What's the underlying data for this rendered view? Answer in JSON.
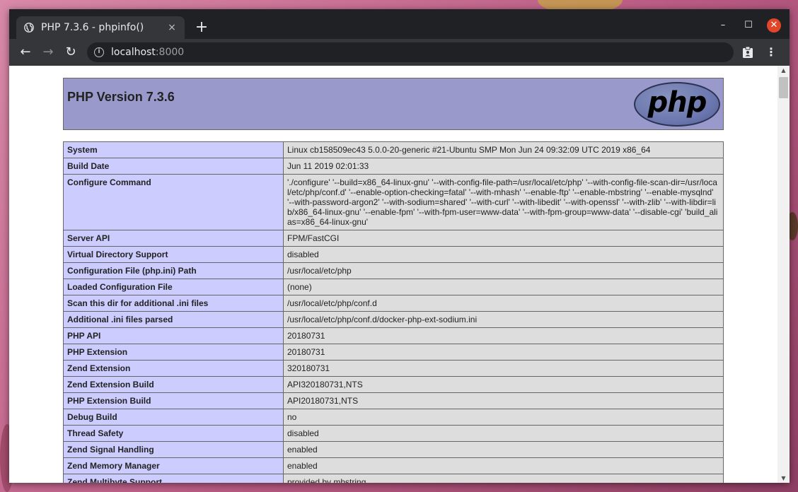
{
  "browser": {
    "tab": {
      "title": "PHP 7.3.6 - phpinfo()",
      "icon": "globe-icon",
      "close": "×"
    },
    "new_tab": "+",
    "window_controls": {
      "minimize": "–",
      "maximize": "☐",
      "close": "✕"
    },
    "nav": {
      "back": "←",
      "forward": "→",
      "reload": "↻"
    },
    "address": {
      "host": "localhost",
      "port": ":8000"
    },
    "extension_icon": "clipboard-icon",
    "menu_icon": "⋮"
  },
  "colors": {
    "header_bg": "#9999cc",
    "label_bg": "#ccccff",
    "value_bg": "#dddddd",
    "titlebar": "#202124",
    "close_button": "#e2462a"
  },
  "page": {
    "version_title": "PHP Version 7.3.6",
    "logo_text": "php",
    "rows": [
      {
        "label": "System",
        "value": "Linux cb158509ec43 5.0.0-20-generic #21-Ubuntu SMP Mon Jun 24 09:32:09 UTC 2019 x86_64"
      },
      {
        "label": "Build Date",
        "value": "Jun 11 2019 02:01:33"
      },
      {
        "label": "Configure Command",
        "value": "'./configure' '--build=x86_64-linux-gnu' '--with-config-file-path=/usr/local/etc/php' '--with-config-file-scan-dir=/usr/local/etc/php/conf.d' '--enable-option-checking=fatal' '--with-mhash' '--enable-ftp' '--enable-mbstring' '--enable-mysqlnd' '--with-password-argon2' '--with-sodium=shared' '--with-curl' '--with-libedit' '--with-openssl' '--with-zlib' '--with-libdir=lib/x86_64-linux-gnu' '--enable-fpm' '--with-fpm-user=www-data' '--with-fpm-group=www-data' '--disable-cgi' 'build_alias=x86_64-linux-gnu'"
      },
      {
        "label": "Server API",
        "value": "FPM/FastCGI"
      },
      {
        "label": "Virtual Directory Support",
        "value": "disabled"
      },
      {
        "label": "Configuration File (php.ini) Path",
        "value": "/usr/local/etc/php"
      },
      {
        "label": "Loaded Configuration File",
        "value": "(none)"
      },
      {
        "label": "Scan this dir for additional .ini files",
        "value": "/usr/local/etc/php/conf.d"
      },
      {
        "label": "Additional .ini files parsed",
        "value": "/usr/local/etc/php/conf.d/docker-php-ext-sodium.ini"
      },
      {
        "label": "PHP API",
        "value": "20180731"
      },
      {
        "label": "PHP Extension",
        "value": "20180731"
      },
      {
        "label": "Zend Extension",
        "value": "320180731"
      },
      {
        "label": "Zend Extension Build",
        "value": "API320180731,NTS"
      },
      {
        "label": "PHP Extension Build",
        "value": "API20180731,NTS"
      },
      {
        "label": "Debug Build",
        "value": "no"
      },
      {
        "label": "Thread Safety",
        "value": "disabled"
      },
      {
        "label": "Zend Signal Handling",
        "value": "enabled"
      },
      {
        "label": "Zend Memory Manager",
        "value": "enabled"
      },
      {
        "label": "Zend Multibyte Support",
        "value": "provided by mbstring"
      }
    ]
  }
}
